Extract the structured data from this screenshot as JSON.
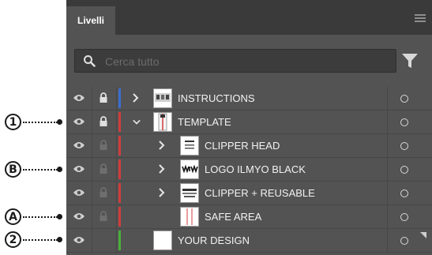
{
  "callouts": [
    "1",
    "B",
    "A",
    "2"
  ],
  "panel": {
    "tab_label": "Livelli",
    "search": {
      "placeholder": "Cerca tutto",
      "value": ""
    }
  },
  "layers": [
    {
      "label": "INSTRUCTIONS",
      "color": "#3b6fd1",
      "expander": "right",
      "lock_visible": true
    },
    {
      "label": "TEMPLATE",
      "color": "#d23c3c",
      "expander": "down",
      "lock_visible": true
    },
    {
      "label": "CLIPPER HEAD",
      "color": "#d23c3c",
      "expander": "right",
      "lock_visible": false
    },
    {
      "label": "LOGO ILMYO BLACK",
      "color": "#d23c3c",
      "expander": "right",
      "lock_visible": false
    },
    {
      "label": "CLIPPER + REUSABLE",
      "color": "#d23c3c",
      "expander": "right",
      "lock_visible": false
    },
    {
      "label": "SAFE AREA",
      "color": "#d23c3c",
      "expander": "none",
      "lock_visible": false
    },
    {
      "label": "YOUR DESIGN",
      "color": "#4caf3a",
      "expander": "none",
      "lock_visible": false
    }
  ]
}
